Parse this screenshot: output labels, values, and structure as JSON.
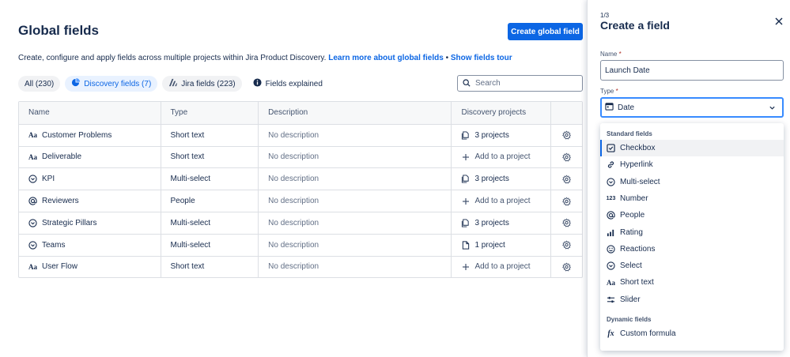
{
  "page": {
    "title": "Global fields",
    "create_button": "Create global field",
    "subtitle": "Create, configure and apply fields across multiple projects within Jira Product Discovery.",
    "learn_more": "Learn more about global fields",
    "separator": "•",
    "tour": "Show fields tour"
  },
  "filters": {
    "all": "All (230)",
    "discovery": "Discovery fields (7)",
    "jira": "Jira fields (223)",
    "explained": "Fields explained"
  },
  "search": {
    "placeholder": "Search"
  },
  "table": {
    "headers": {
      "name": "Name",
      "type": "Type",
      "description": "Description",
      "projects": "Discovery projects"
    },
    "rows": [
      {
        "icon": "short-text-icon",
        "name": "Customer Problems",
        "type": "Short text",
        "description": "No description",
        "projects": "3 projects",
        "projects_kind": "count"
      },
      {
        "icon": "short-text-icon",
        "name": "Deliverable",
        "type": "Short text",
        "description": "No description",
        "projects": "Add to a project",
        "projects_kind": "add"
      },
      {
        "icon": "select-icon",
        "name": "KPI",
        "type": "Multi-select",
        "description": "No description",
        "projects": "3 projects",
        "projects_kind": "count"
      },
      {
        "icon": "people-icon",
        "name": "Reviewers",
        "type": "People",
        "description": "No description",
        "projects": "Add to a project",
        "projects_kind": "add"
      },
      {
        "icon": "select-icon",
        "name": "Strategic Pillars",
        "type": "Multi-select",
        "description": "No description",
        "projects": "3 projects",
        "projects_kind": "count"
      },
      {
        "icon": "select-icon",
        "name": "Teams",
        "type": "Multi-select",
        "description": "No description",
        "projects": "1 project",
        "projects_kind": "count"
      },
      {
        "icon": "short-text-icon",
        "name": "User Flow",
        "type": "Short text",
        "description": "No description",
        "projects": "Add to a project",
        "projects_kind": "add"
      }
    ]
  },
  "panel": {
    "step": "1/3",
    "title": "Create a field",
    "name_label": "Name",
    "required_mark": "*",
    "name_value": "Launch Date",
    "type_label": "Type",
    "type_value": "Date",
    "standard_heading": "Standard fields",
    "standard_options": [
      "Checkbox",
      "Hyperlink",
      "Multi-select",
      "Number",
      "People",
      "Rating",
      "Reactions",
      "Select",
      "Short text",
      "Slider"
    ],
    "dynamic_heading": "Dynamic fields",
    "dynamic_options": [
      "Custom formula"
    ],
    "selected_option": "Checkbox"
  },
  "colors": {
    "accent": "#0c66e4",
    "focus": "#388bff",
    "text": "#172b4d",
    "muted": "#626f86"
  }
}
